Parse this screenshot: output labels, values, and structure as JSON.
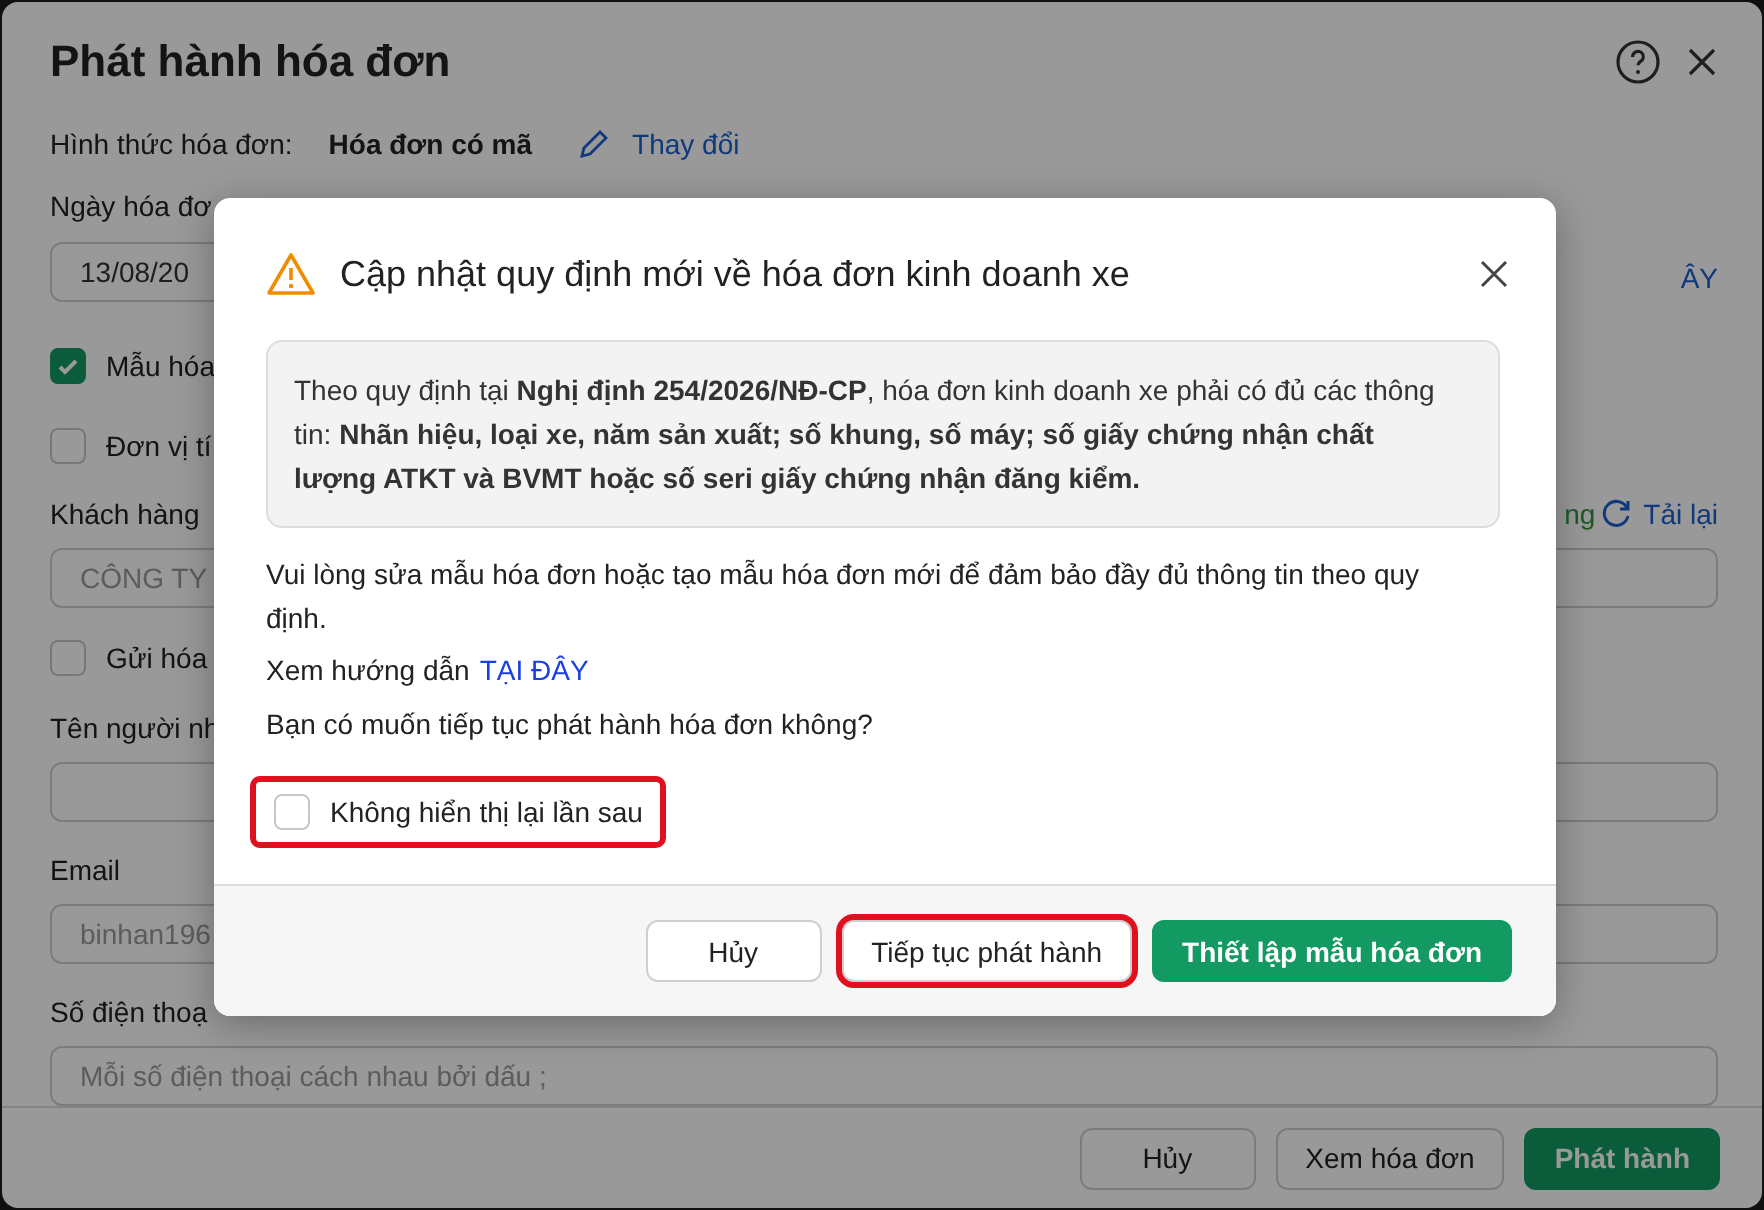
{
  "window": {
    "title": "Phát hành hóa đơn"
  },
  "form": {
    "invoice_type_label": "Hình thức hóa đơn:",
    "invoice_type_value": "Hóa đơn có mã",
    "change_link": "Thay đổi",
    "date_label": "Ngày hóa đơ",
    "date_value": "13/08/20",
    "guide_link_fragment": "ÂY",
    "options": [
      {
        "label": "Mẫu hóa",
        "checked": true
      },
      {
        "label": "Đơn vị tí",
        "checked": false
      }
    ],
    "customer_label": "Khách hàng",
    "customer_value": "CÔNG TY",
    "customer_status": "ng",
    "reload_link": "Tải lại",
    "send_option": {
      "label": "Gửi hóa",
      "checked": false
    },
    "recipient_label": "Tên người nh",
    "email_label": "Email",
    "email_value": "binhan196",
    "phone_label": "Số điện thoạ",
    "phone_placeholder": "Mỗi số điện thoại cách nhau bởi dấu ;"
  },
  "footer_buttons": [
    {
      "label": "Hủy",
      "kind": "secondary"
    },
    {
      "label": "Xem hóa đơn",
      "kind": "secondary"
    },
    {
      "label": "Phát hành",
      "kind": "primary"
    }
  ],
  "modal": {
    "title": "Cập nhật quy định mới về hóa đơn kinh doanh xe",
    "notice": "Theo quy định tại **Nghị định 254/2026/NĐ-CP**, hóa đơn kinh doanh xe phải có đủ các thông tin: **Nhãn hiệu, loại xe, năm sản xuất; số khung, số máy; số giấy chứng nhận chất lượng ATKT và BVMT hoặc số seri giấy chứng nhận đăng kiểm.**",
    "body": "Vui lòng sửa mẫu hóa đơn hoặc tạo mẫu hóa đơn mới để đảm bảo đầy đủ thông tin theo quy định.",
    "guide_text": "Xem hướng dẫn",
    "guide_link": "TẠI ĐÂY",
    "question": "Bạn có muốn tiếp tục phát hành hóa đơn không?",
    "dont_show": {
      "label": "Không hiển thị lại lần sau",
      "checked": false,
      "highlighted": true
    },
    "buttons": [
      {
        "label": "Hủy",
        "kind": "secondary",
        "highlighted": false
      },
      {
        "label": "Tiếp tục phát hành",
        "kind": "secondary",
        "highlighted": true
      },
      {
        "label": "Thiết lập mẫu hóa đơn",
        "kind": "primary",
        "highlighted": false
      }
    ]
  }
}
